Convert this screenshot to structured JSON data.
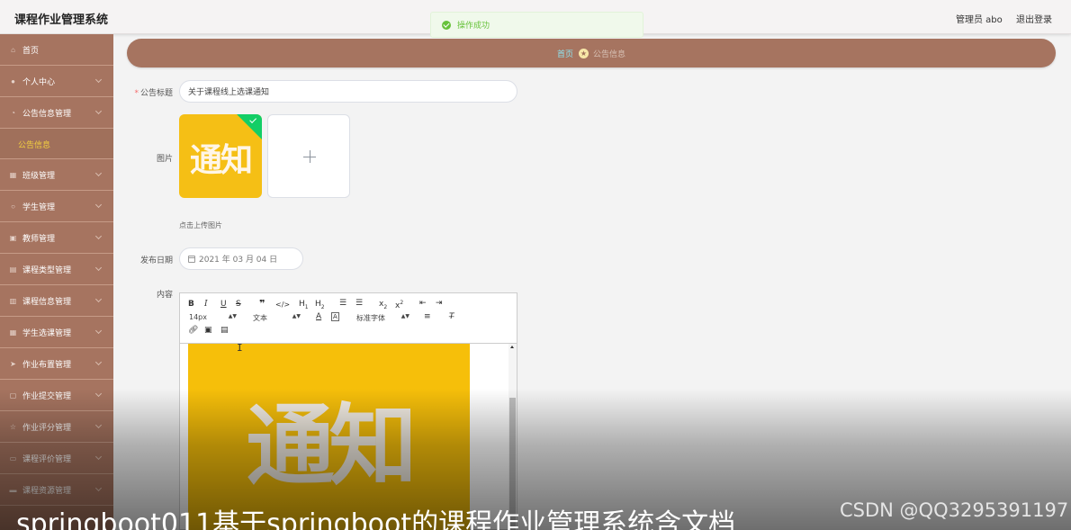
{
  "app": {
    "title": "课程作业管理系统"
  },
  "header": {
    "user": "管理员 abo",
    "logout": "退出登录"
  },
  "toast": {
    "message": "操作成功",
    "color": "#67c23a"
  },
  "sidebar": {
    "items": [
      {
        "label": "首页",
        "icon": "home-icon"
      },
      {
        "label": "个人中心",
        "icon": "user-icon"
      },
      {
        "label": "公告信息管理",
        "icon": "bell-icon",
        "sub": "公告信息"
      },
      {
        "label": "班级管理",
        "icon": "grid-icon"
      },
      {
        "label": "学生管理",
        "icon": "user-icon"
      },
      {
        "label": "教师管理",
        "icon": "id-card-icon"
      },
      {
        "label": "课程类型管理",
        "icon": "list-icon"
      },
      {
        "label": "课程信息管理",
        "icon": "chart-icon"
      },
      {
        "label": "学生选课管理",
        "icon": "grid-icon"
      },
      {
        "label": "作业布置管理",
        "icon": "send-icon"
      },
      {
        "label": "作业提交管理",
        "icon": "upload-icon"
      },
      {
        "label": "作业评分管理",
        "icon": "star-icon"
      },
      {
        "label": "课程评价管理",
        "icon": "comment-icon"
      },
      {
        "label": "课程资源管理",
        "icon": "folder-icon"
      }
    ],
    "accent": "#a67460",
    "active_sub_color": "#f3d03f"
  },
  "breadcrumb": {
    "home": "首页",
    "current": "公告信息"
  },
  "form": {
    "title_label": "公告标题",
    "title_value": "关于课程线上选课通知",
    "image_label": "图片",
    "image_text": "通知",
    "upload_hint": "点击上传图片",
    "date_label": "发布日期",
    "date_value": "2021 年 03 月 04 日",
    "content_label": "内容"
  },
  "editor": {
    "font_size": "14px",
    "block_format": "文本",
    "font_family": "标准字体",
    "content_image_text": "通知"
  },
  "overlay": {
    "caption": "springboot011基于springboot的课程作业管理系统含文档",
    "watermark": "CSDN @QQ3295391197"
  }
}
